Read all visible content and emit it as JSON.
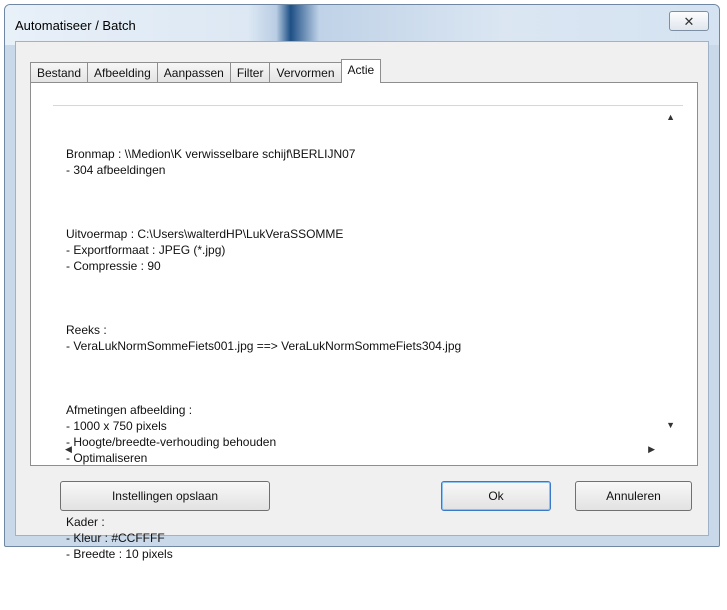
{
  "window": {
    "title": "Automatiseer / Batch",
    "close_symbol": "✕"
  },
  "tabs": [
    {
      "label": "Bestand",
      "active": false
    },
    {
      "label": "Afbeelding",
      "active": false
    },
    {
      "label": "Aanpassen",
      "active": false
    },
    {
      "label": "Filter",
      "active": false
    },
    {
      "label": "Vervormen",
      "active": false
    },
    {
      "label": "Actie",
      "active": true
    }
  ],
  "summary": {
    "blocks": [
      [
        "Bronmap : \\\\Medion\\K verwisselbare schijf\\BERLIJN07",
        "- 304 afbeeldingen"
      ],
      [
        "Uitvoermap : C:\\Users\\walterdHP\\LukVeraSSOMME",
        "- Exportformaat : JPEG (*.jpg)",
        "- Compressie : 90"
      ],
      [
        "Reeks :",
        "- VeraLukNormSommeFiets001.jpg ==> VeraLukNormSommeFiets304.jpg"
      ],
      [
        "Afmetingen afbeelding :",
        "- 1000 x 750 pixels",
        "- Hoogte/breedte-verhouding behouden",
        "- Optimaliseren"
      ],
      [
        "Kader :",
        "- Kleur : #CCFFFF",
        "- Breedte : 10 pixels"
      ]
    ]
  },
  "scrollbar": {
    "up_icon": "▲",
    "down_icon": "▼",
    "left_icon": "◀",
    "right_icon": "▶"
  },
  "buttons": {
    "save_label": "Instellingen opslaan",
    "ok_label": "Ok",
    "cancel_label": "Annuleren"
  }
}
